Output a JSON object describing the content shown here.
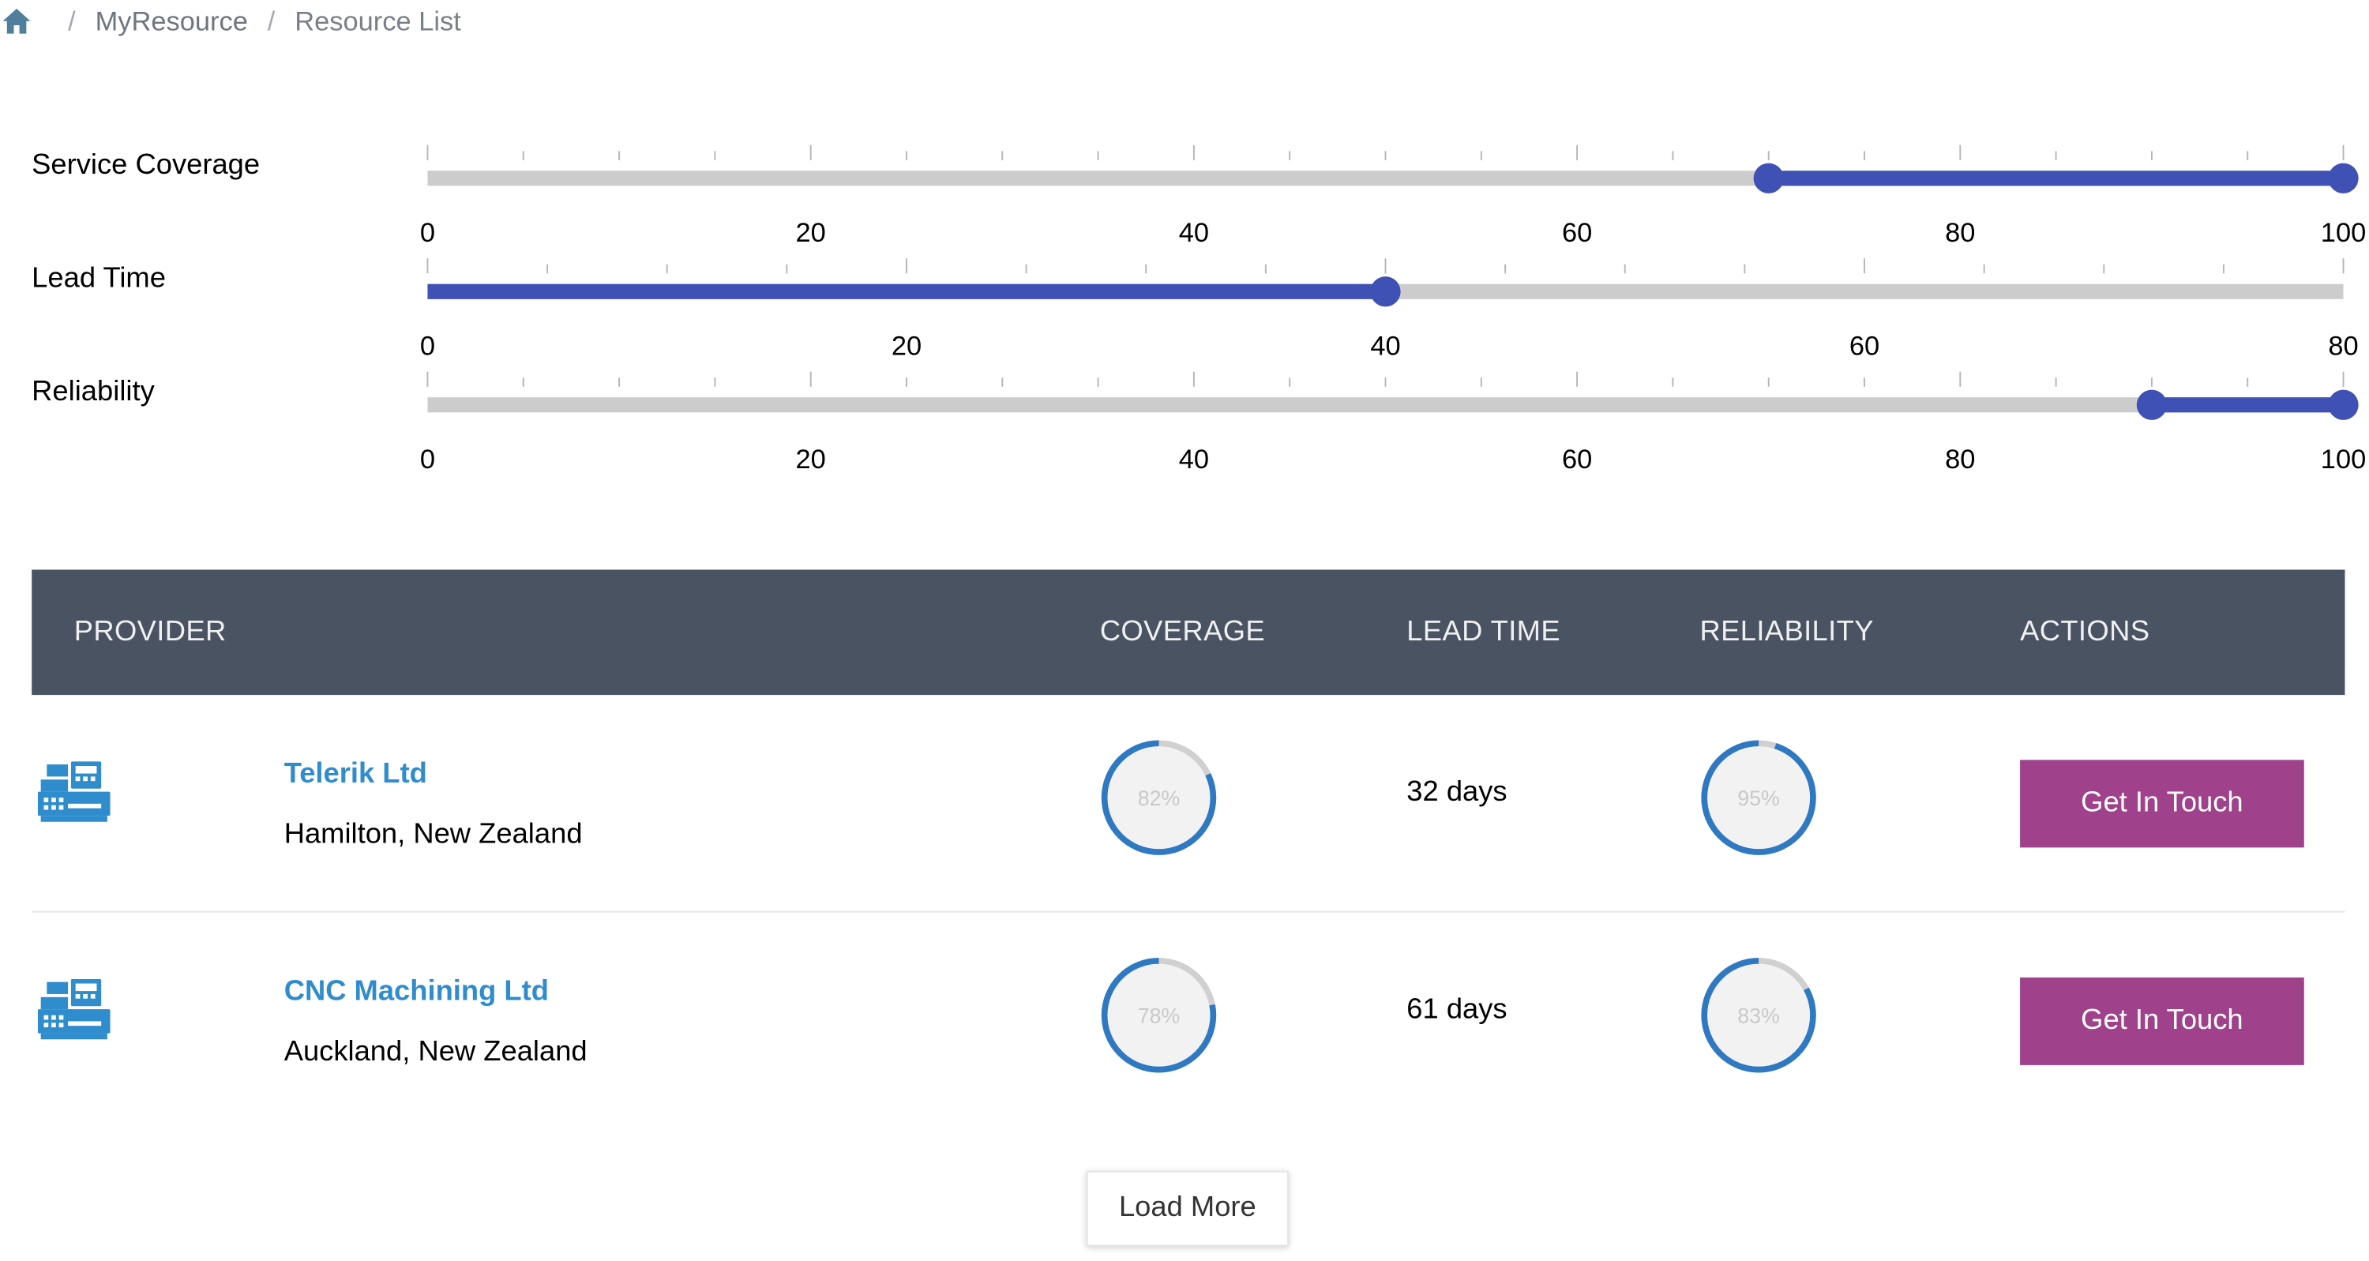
{
  "breadcrumb": {
    "home_icon": "home-icon",
    "items": [
      {
        "label": "MyResource"
      },
      {
        "label": "Resource List"
      }
    ],
    "separator": "/"
  },
  "filters": [
    {
      "label": "Service Coverage",
      "min": 0,
      "max": 100,
      "selected": [
        70,
        100
      ],
      "ticks": [
        "0",
        "20",
        "40",
        "60",
        "80",
        "100"
      ],
      "tick_values": [
        0,
        20,
        40,
        60,
        80,
        100
      ],
      "minor_step": 5
    },
    {
      "label": "Lead Time",
      "min": 0,
      "max": 80,
      "selected": [
        0,
        40
      ],
      "ticks": [
        "0",
        "20",
        "40",
        "60",
        "80"
      ],
      "tick_values": [
        0,
        20,
        40,
        60,
        80
      ],
      "minor_step": 5
    },
    {
      "label": "Reliability",
      "min": 0,
      "max": 100,
      "selected": [
        90,
        100
      ],
      "ticks": [
        "0",
        "20",
        "40",
        "60",
        "80",
        "100"
      ],
      "tick_values": [
        0,
        20,
        40,
        60,
        80,
        100
      ],
      "minor_step": 5
    }
  ],
  "table": {
    "headers": {
      "provider": "PROVIDER",
      "coverage": "COVERAGE",
      "lead_time": "LEAD TIME",
      "reliability": "RELIABILITY",
      "actions": "ACTIONS"
    },
    "rows": [
      {
        "icon": "cash-register-icon",
        "name": "Telerik Ltd",
        "location": "Hamilton, New Zealand",
        "coverage": 82,
        "coverage_label": "82%",
        "lead_time": "32 days",
        "reliability": 95,
        "reliability_label": "95%",
        "action": "Get In Touch"
      },
      {
        "icon": "cash-register-icon",
        "name": "CNC Machining Ltd",
        "location": "Auckland, New Zealand",
        "coverage": 78,
        "coverage_label": "78%",
        "lead_time": "61 days",
        "reliability": 83,
        "reliability_label": "83%",
        "action": "Get In Touch"
      }
    ]
  },
  "load_more": "Load More",
  "colors": {
    "slider_track": "#cccccc",
    "slider_selection": "#3f51b5",
    "header_bg": "#4a5361",
    "link": "#2f8ccd",
    "action_button": "#a0418b",
    "gauge_track": "#d0d0d0",
    "gauge_value": "#2f79c3",
    "gauge_fill": "#f2f2f2"
  }
}
